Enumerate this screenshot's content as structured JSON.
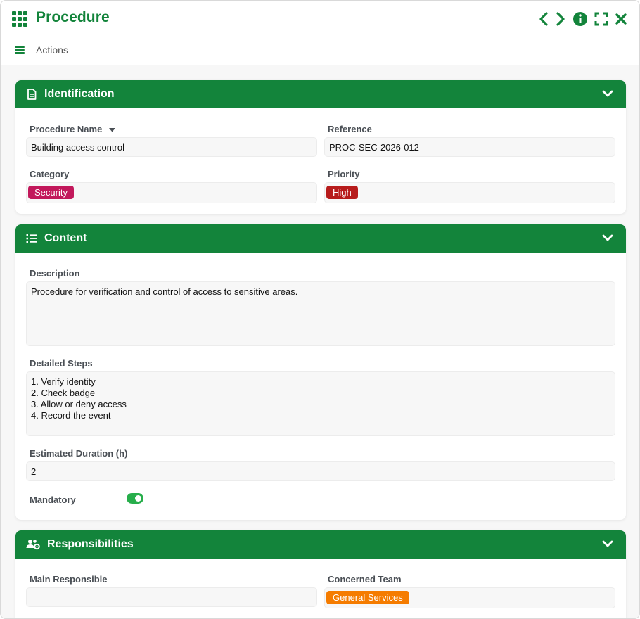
{
  "window": {
    "title": "Procedure",
    "actions_label": "Actions"
  },
  "colors": {
    "brand": "#13843b",
    "security_tag": "#c2185b",
    "high_tag": "#b71c1c",
    "team_tag": "#f57c00",
    "toggle_on": "#27ae4b"
  },
  "identification": {
    "title": "Identification",
    "procedure_name_label": "Procedure Name",
    "procedure_name_value": "Building access control",
    "reference_label": "Reference",
    "reference_value": "PROC-SEC-2026-012",
    "category_label": "Category",
    "category_tag": "Security",
    "priority_label": "Priority",
    "priority_tag": "High"
  },
  "content": {
    "title": "Content",
    "description_label": "Description",
    "description_value": "Procedure for verification and control of access to sensitive areas.",
    "steps_label": "Detailed Steps",
    "steps_value": "1. Verify identity\n2. Check badge\n3. Allow or deny access\n4. Record the event",
    "duration_label": "Estimated Duration (h)",
    "duration_value": "2",
    "mandatory_label": "Mandatory",
    "mandatory_on": true
  },
  "responsibilities": {
    "title": "Responsibilities",
    "main_responsible_label": "Main Responsible",
    "main_responsible_value": "",
    "team_label": "Concerned Team",
    "team_tag": "General Services"
  },
  "icons": {
    "app": "app-grid-icon",
    "prev": "chevron-left-icon",
    "next": "chevron-right-icon",
    "info": "info-icon",
    "fullscreen": "fullscreen-icon",
    "close": "close-icon",
    "menu": "hamburger-icon",
    "identification": "document-icon",
    "content": "list-icon",
    "responsibilities": "users-gear-icon",
    "collapse": "chevron-down-icon",
    "dropdown": "caret-down-icon"
  }
}
